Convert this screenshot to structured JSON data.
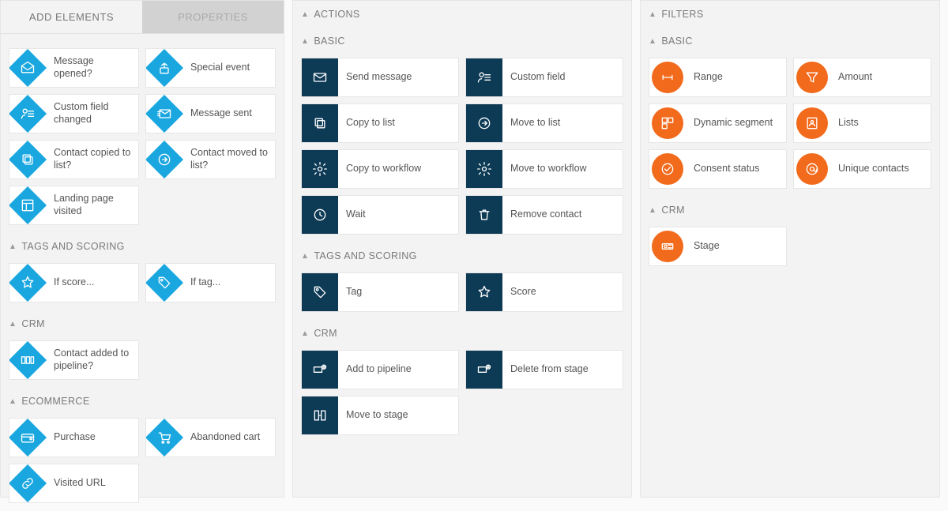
{
  "left": {
    "tabs": {
      "active": "ADD ELEMENTS",
      "inactive": "PROPERTIES"
    },
    "groups": [
      {
        "id": "events",
        "header": null,
        "items": [
          {
            "icon": "envelope-open",
            "label": "Message opened?"
          },
          {
            "icon": "event",
            "label": "Special event"
          },
          {
            "icon": "user-field",
            "label": "Custom field changed"
          },
          {
            "icon": "envelope-sent",
            "label": "Message sent"
          },
          {
            "icon": "copy",
            "label": "Contact copied to list?"
          },
          {
            "icon": "move",
            "label": "Contact moved to list?"
          },
          {
            "icon": "landing",
            "label": "Landing page visited"
          }
        ]
      },
      {
        "id": "tags",
        "header": "TAGS AND SCORING",
        "items": [
          {
            "icon": "star",
            "label": "If score..."
          },
          {
            "icon": "tag",
            "label": "If tag..."
          }
        ]
      },
      {
        "id": "crm",
        "header": "CRM",
        "items": [
          {
            "icon": "pipeline",
            "label": "Contact added to pipeline?"
          }
        ]
      },
      {
        "id": "ecom",
        "header": "ECOMMERCE",
        "items": [
          {
            "icon": "wallet",
            "label": "Purchase"
          },
          {
            "icon": "cart",
            "label": "Abandoned cart"
          },
          {
            "icon": "link",
            "label": "Visited URL"
          }
        ]
      }
    ]
  },
  "mid": {
    "title": "ACTIONS",
    "groups": [
      {
        "id": "basic",
        "header": "BASIC",
        "items": [
          {
            "icon": "envelope",
            "label": "Send message"
          },
          {
            "icon": "user-field",
            "label": "Custom field"
          },
          {
            "icon": "copy",
            "label": "Copy to list"
          },
          {
            "icon": "move",
            "label": "Move to list"
          },
          {
            "icon": "gear",
            "label": "Copy to workflow"
          },
          {
            "icon": "gear",
            "label": "Move to workflow"
          },
          {
            "icon": "clock",
            "label": "Wait"
          },
          {
            "icon": "trash",
            "label": "Remove contact"
          }
        ]
      },
      {
        "id": "tags",
        "header": "TAGS AND SCORING",
        "items": [
          {
            "icon": "tag",
            "label": "Tag"
          },
          {
            "icon": "star",
            "label": "Score"
          }
        ]
      },
      {
        "id": "crm",
        "header": "CRM",
        "items": [
          {
            "icon": "pipeline-add",
            "label": "Add to pipeline"
          },
          {
            "icon": "pipeline-delete",
            "label": "Delete from stage"
          },
          {
            "icon": "pipeline-move",
            "label": "Move to stage"
          }
        ]
      }
    ]
  },
  "right": {
    "title": "FILTERS",
    "groups": [
      {
        "id": "basic",
        "header": "BASIC",
        "items": [
          {
            "icon": "range",
            "label": "Range"
          },
          {
            "icon": "funnel",
            "label": "Amount"
          },
          {
            "icon": "segment",
            "label": "Dynamic segment"
          },
          {
            "icon": "list",
            "label": "Lists"
          },
          {
            "icon": "consent",
            "label": "Consent status"
          },
          {
            "icon": "at",
            "label": "Unique contacts"
          }
        ]
      },
      {
        "id": "crm",
        "header": "CRM",
        "items": [
          {
            "icon": "stage",
            "label": "Stage"
          }
        ]
      }
    ]
  },
  "colors": {
    "blue": "#1aa7e0",
    "navy": "#0d3a55",
    "orange": "#f26a1b"
  }
}
